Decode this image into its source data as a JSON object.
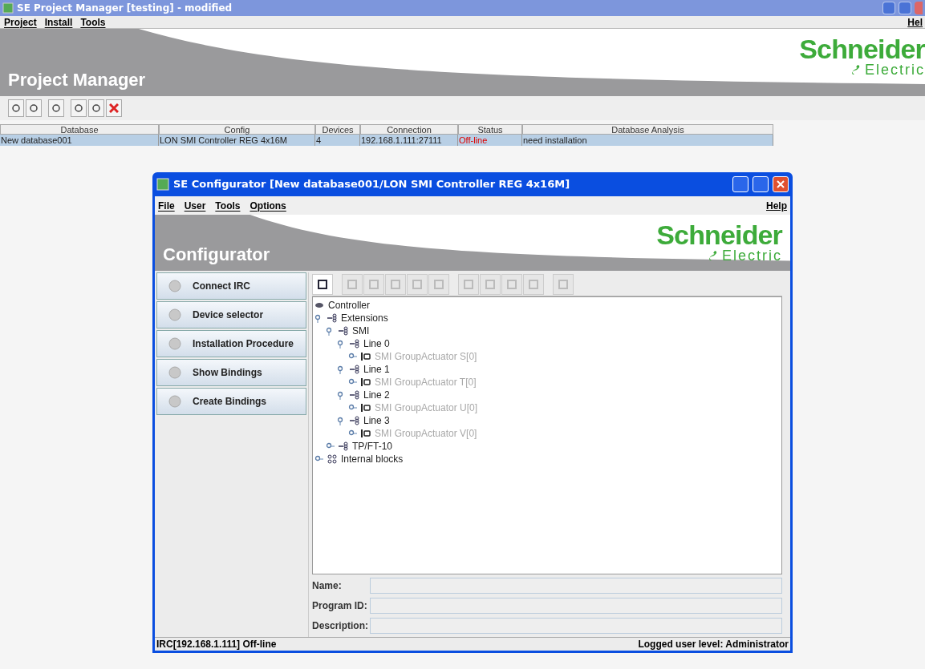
{
  "window": {
    "title": "SE Project Manager [testing] - modified"
  },
  "menu": [
    "Project",
    "Install",
    "Tools"
  ],
  "help": "Hel",
  "banner": {
    "title": "Project Manager",
    "logo_top": "Schneider",
    "logo_bottom": "Electric"
  },
  "table": {
    "columns": [
      "Database",
      "Config",
      "Devices",
      "Connection",
      "Status",
      "Database Analysis"
    ],
    "rows": [
      {
        "selected": true,
        "cells": [
          "New database001",
          "LON SMI Controller REG 4x16M",
          "4",
          "192.168.1.111:27111",
          "Off-line",
          "need installation"
        ]
      }
    ]
  },
  "configurator": {
    "title": "SE Configurator [New database001/LON SMI Controller REG 4x16M]",
    "menu": [
      "File",
      "User",
      "Tools",
      "Options"
    ],
    "help": "Help",
    "banner": {
      "title": "Configurator",
      "logo_top": "Schneider",
      "logo_bottom": "Electric"
    },
    "side_buttons": [
      "Connect IRC",
      "Device selector",
      "Installation Procedure",
      "Show Bindings",
      "Create Bindings"
    ],
    "toolbar": [
      {
        "disabled": false
      },
      {
        "disabled": true
      },
      {
        "disabled": true
      },
      {
        "disabled": true
      },
      {
        "disabled": true
      },
      {
        "disabled": true
      },
      {
        "disabled": true
      },
      {
        "disabled": true
      },
      {
        "disabled": true
      },
      {
        "disabled": true
      },
      {
        "disabled": true
      }
    ],
    "tree": [
      {
        "label": "Controller",
        "kind": "controller",
        "disabled": false,
        "children": [
          {
            "label": "Extensions",
            "kind": "bus",
            "disabled": false,
            "expanded": true,
            "children": [
              {
                "label": "SMI",
                "kind": "bus",
                "disabled": false,
                "expanded": true,
                "children": [
                  {
                    "label": "Line 0",
                    "kind": "bus",
                    "disabled": false,
                    "expanded": true,
                    "children": [
                      {
                        "label": "SMI GroupActuator S[0]",
                        "kind": "device",
                        "disabled": true,
                        "expanded": false
                      }
                    ]
                  },
                  {
                    "label": "Line 1",
                    "kind": "bus",
                    "disabled": false,
                    "expanded": true,
                    "children": [
                      {
                        "label": "SMI GroupActuator T[0]",
                        "kind": "device",
                        "disabled": true,
                        "expanded": false
                      }
                    ]
                  },
                  {
                    "label": "Line 2",
                    "kind": "bus",
                    "disabled": false,
                    "expanded": true,
                    "children": [
                      {
                        "label": "SMI GroupActuator U[0]",
                        "kind": "device",
                        "disabled": true,
                        "expanded": false
                      }
                    ]
                  },
                  {
                    "label": "Line 3",
                    "kind": "bus",
                    "disabled": false,
                    "expanded": true,
                    "children": [
                      {
                        "label": "SMI GroupActuator V[0]",
                        "kind": "device",
                        "disabled": true,
                        "expanded": false
                      }
                    ]
                  }
                ]
              },
              {
                "label": "TP/FT-10",
                "kind": "bus",
                "disabled": false,
                "expanded": false
              }
            ]
          },
          {
            "label": "Internal blocks",
            "kind": "blocks",
            "disabled": false,
            "expanded": false
          }
        ]
      }
    ],
    "fields": [
      {
        "label": "Name:"
      },
      {
        "label": "Program ID:"
      },
      {
        "label": "Description:"
      }
    ],
    "status_left": "IRC[192.168.1.111] Off-line",
    "status_right": "Logged user level: Administrator"
  }
}
